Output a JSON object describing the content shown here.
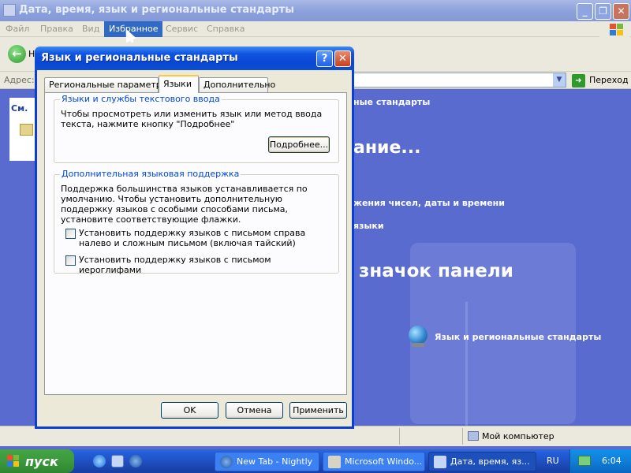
{
  "background_window": {
    "title": "Дата, время, язык и региональные стандарты",
    "menu": [
      "Файл",
      "Правка",
      "Вид",
      "Избранное",
      "Сервис",
      "Справка"
    ],
    "menu_selected": "Избранное",
    "toolbar": {
      "back_label": "Н"
    },
    "address": {
      "label": "Адрес:",
      "go_label": "Переход"
    },
    "left_pane": {
      "title": "См."
    },
    "content": {
      "breadcrumb_1": "ные стандарты",
      "heading": "ание...",
      "task_1": "жения чисел, даты и времени",
      "task_2": "языки",
      "heading_2": "значок панели",
      "applet_label": "Язык и региональные стандарты"
    },
    "status": {
      "location": "Мой компьютер"
    }
  },
  "dialog": {
    "title": "Язык и региональные стандарты",
    "help_glyph": "?",
    "close_glyph": "✕",
    "tabs": [
      {
        "label": "Региональные параметры",
        "active": false
      },
      {
        "label": "Языки",
        "active": true
      },
      {
        "label": "Дополнительно",
        "active": false
      }
    ],
    "group_text_input": {
      "legend": "Языки и службы текстового ввода",
      "text": "Чтобы просмотреть или изменить язык или метод ввода текста, нажмите кнопку \"Подробнее\"",
      "details_button": "Подробнее..."
    },
    "group_additional": {
      "legend": "Дополнительная языковая поддержка",
      "text": "Поддержка большинства языков устанавливается по умолчанию. Чтобы установить дополнительную поддержку языков с особыми способами письма, установите соответствующие флажки.",
      "checkboxes": [
        {
          "label": "Установить поддержку языков с письмом справа налево и сложным письмом (включая тайский)",
          "checked": false
        },
        {
          "label": "Установить поддержку языков с письмом иероглифами",
          "checked": false
        }
      ]
    },
    "buttons": {
      "ok": "OK",
      "cancel": "Отмена",
      "apply": "Применить"
    }
  },
  "taskbar": {
    "start_label": "пуск",
    "tasks": [
      {
        "label": "New Tab - Nightly",
        "active": false
      },
      {
        "label": "Microsoft Windo...",
        "active": false
      },
      {
        "label": "Дата, время, яз...",
        "active": true
      }
    ],
    "language": "RU",
    "clock": "6:04"
  },
  "colors": {
    "desktop_blue": "#5a6bd0",
    "dialog_title_blue": "#0a46d4",
    "group_legend_blue": "#0046d5",
    "taskbar_blue": "#245edb",
    "start_green": "#3c983c"
  }
}
